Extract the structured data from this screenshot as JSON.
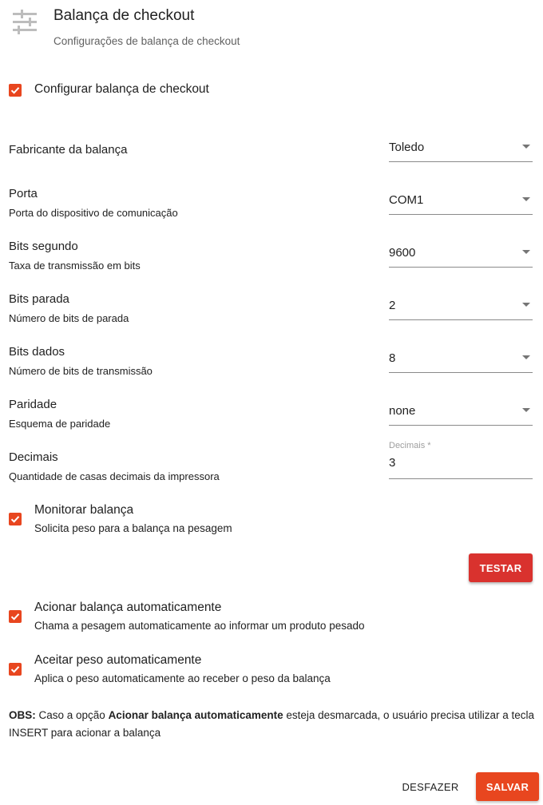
{
  "header": {
    "icon": "tune-sliders-icon",
    "title": "Balança de checkout",
    "subtitle": "Configurações de balança de checkout"
  },
  "configure": {
    "label": "Configurar balança de checkout",
    "checked": true
  },
  "fields": {
    "fabricante": {
      "label": "Fabricante da balança",
      "value": "Toledo"
    },
    "porta": {
      "label": "Porta",
      "description": "Porta do dispositivo de comunicação",
      "value": "COM1"
    },
    "bits_segundo": {
      "label": "Bits segundo",
      "description": "Taxa de transmissão em bits",
      "value": "9600"
    },
    "bits_parada": {
      "label": "Bits parada",
      "description": "Número de bits de parada",
      "value": "2"
    },
    "bits_dados": {
      "label": "Bits dados",
      "description": "Número de bits de transmissão",
      "value": "8"
    },
    "paridade": {
      "label": "Paridade",
      "description": "Esquema de paridade",
      "value": "none"
    },
    "decimais": {
      "label": "Decimais",
      "description": "Quantidade de casas decimais da impressora",
      "input_label": "Decimais *",
      "value": "3"
    }
  },
  "monitor": {
    "label": "Monitorar balança",
    "description": "Solicita peso para a balança na pesagem",
    "checked": true
  },
  "test_button": "TESTAR",
  "auto_trigger": {
    "label": "Acionar balança automaticamente",
    "description": "Chama a pesagem automaticamente ao informar um produto pesado",
    "checked": true
  },
  "auto_accept": {
    "label": "Aceitar peso automaticamente",
    "description": "Aplica o peso automaticamente ao receber o peso da balança",
    "checked": true
  },
  "obs": {
    "prefix": "OBS:",
    "part1": " Caso a opção ",
    "bold": "Acionar balança automaticamente",
    "part2": " esteja desmarcada, o usuário precisa utilizar a tecla INSERT para acionar a balança"
  },
  "actions": {
    "undo": "DESFAZER",
    "save": "SALVAR"
  },
  "colors": {
    "accent": "#e8461f",
    "test_button": "#d9322e"
  }
}
